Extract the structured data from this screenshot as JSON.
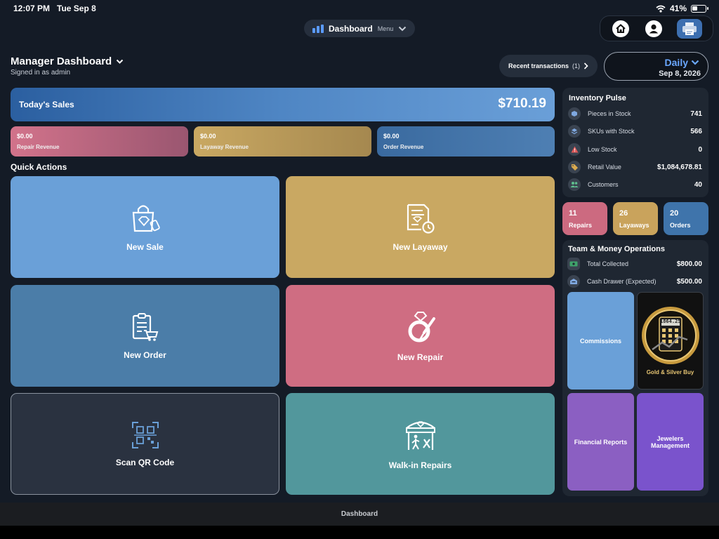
{
  "status_bar": {
    "time_date": "12:07 PM   Tue Sep 8",
    "battery": "41%",
    "icons": [
      "wifi-icon",
      "battery-icon"
    ]
  },
  "top_nav": {
    "title": "Dashboard",
    "menu": "Menu",
    "icon": "bar-chart-icon"
  },
  "header_icons": [
    "home-icon",
    "profile-icon",
    "printer-icon"
  ],
  "header": {
    "title": "Manager Dashboard",
    "subtitle": "Signed in as admin"
  },
  "recent": {
    "label": "Recent transactions",
    "count": "(1)"
  },
  "period": {
    "label": "Daily",
    "date": "Sep 8, 2026"
  },
  "sales": {
    "label": "Today's Sales",
    "value": "$710.19"
  },
  "revenues": [
    {
      "value": "$0.00",
      "label": "Repair Revenue",
      "color": "#c96a82"
    },
    {
      "value": "$0.00",
      "label": "Layaway Revenue",
      "color": "#b9985a"
    },
    {
      "value": "$0.00",
      "label": "Order Revenue",
      "color": "#3f70a6"
    }
  ],
  "quick_actions": {
    "title": "Quick Actions",
    "items": [
      {
        "label": "New Sale",
        "icon": "shopping-bag-icon",
        "color": "#6aa0d8"
      },
      {
        "label": "New Layaway",
        "icon": "invoice-clock-icon",
        "color": "#c9a862"
      },
      {
        "label": "New Order",
        "icon": "clipboard-cart-icon",
        "color": "#4b7da8"
      },
      {
        "label": "New Repair",
        "icon": "ring-screwdriver-icon",
        "color": "#cf6d82"
      },
      {
        "label": "Scan QR Code",
        "icon": "qr-code-icon",
        "color": "#2a3240"
      },
      {
        "label": "Walk-in Repairs",
        "icon": "storefront-icon",
        "color": "#52979c"
      }
    ]
  },
  "inventory": {
    "title": "Inventory Pulse",
    "rows": [
      {
        "label": "Pieces in Stock",
        "value": "741",
        "icon": "cube-icon"
      },
      {
        "label": "SKUs with Stock",
        "value": "566",
        "icon": "layers-icon"
      },
      {
        "label": "Low Stock",
        "value": "0",
        "icon": "warning-icon"
      },
      {
        "label": "Retail Value",
        "value": "$1,084,678.81",
        "icon": "tag-icon"
      },
      {
        "label": "Customers",
        "value": "40",
        "icon": "people-icon"
      }
    ]
  },
  "counts": [
    {
      "number": "11",
      "label": "Repairs",
      "color": "#cc6a80"
    },
    {
      "number": "26",
      "label": "Layaways",
      "color": "#c9a35c"
    },
    {
      "number": "20",
      "label": "Orders",
      "color": "#3f74ab"
    }
  ],
  "team": {
    "title": "Team & Money Operations",
    "rows": [
      {
        "label": "Total Collected",
        "value": "$800.00",
        "icon": "cash-icon"
      },
      {
        "label": "Cash Drawer (Expected)",
        "value": "$500.00",
        "icon": "drawer-icon"
      }
    ],
    "tiles": [
      {
        "label": "Commissions",
        "color": "#6aa0d8"
      },
      {
        "label": "Gold & Silver Buy",
        "color": "#111111",
        "display": "1864.25"
      },
      {
        "label": "Financial Reports",
        "color": "#8b5fc2"
      },
      {
        "label": "Jewelers Management",
        "color": "#7a53cc"
      }
    ]
  },
  "footer": {
    "tab": "Dashboard"
  }
}
